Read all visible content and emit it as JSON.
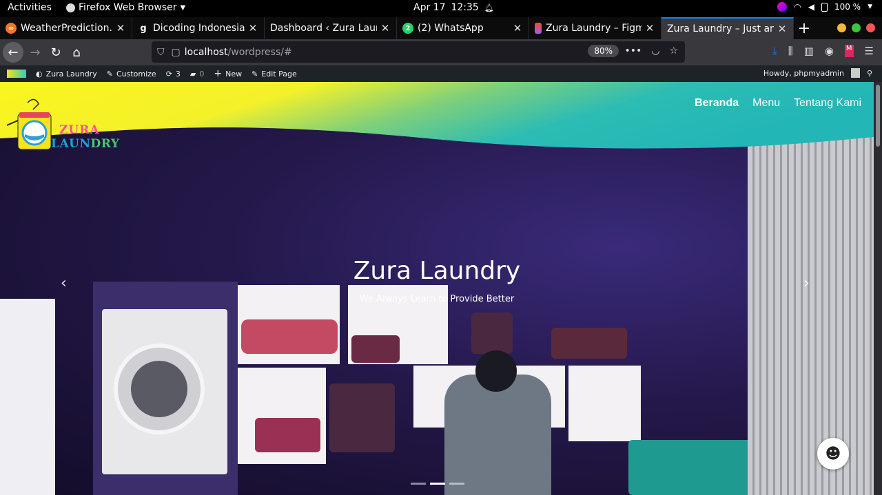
{
  "topbar": {
    "activities": "Activities",
    "app": "Firefox Web Browser",
    "date": "Apr 17",
    "time": "12:35",
    "battery": "100 %"
  },
  "tabs": [
    {
      "title": "WeatherPrediction.ipy",
      "icon": "jupyter-icon",
      "color": "#f37626"
    },
    {
      "title": "Dicoding Indonesia",
      "icon": "dicoding-icon",
      "color": "#2d3e50"
    },
    {
      "title": "Dashboard ‹ Zura Laund",
      "icon": "wordpress-icon",
      "color": "#21759b"
    },
    {
      "title": "(2) WhatsApp",
      "icon": "whatsapp-icon",
      "color": "#25d366"
    },
    {
      "title": "Zura Laundry – Figm",
      "icon": "figma-icon",
      "color": "#f24e1e"
    },
    {
      "title": "Zura Laundry – Just ano",
      "icon": "page-icon",
      "color": "#888888"
    }
  ],
  "url": {
    "host": "localhost",
    "path": "/wordpress/#",
    "zoom": "80%"
  },
  "wpbar": {
    "site": "Zura Laundry",
    "customize": "Customize",
    "updates": "3",
    "comments": "0",
    "new": "New",
    "edit": "Edit Page",
    "howdy": "Howdy, phpmyadmin"
  },
  "site": {
    "brand_top": "ZURA",
    "brand_bottom_a": "LAUN",
    "brand_bottom_b": "DRY",
    "nav": [
      "Beranda",
      "Menu",
      "Tentang Kami"
    ],
    "hero_title": "Zura Laundry",
    "hero_subtitle": "We Always Learn to Provide Better"
  },
  "colors": {
    "header_yellow": "#f7f21c",
    "header_teal": "#22b8b8",
    "wall_purple": "#2a1d5e"
  }
}
